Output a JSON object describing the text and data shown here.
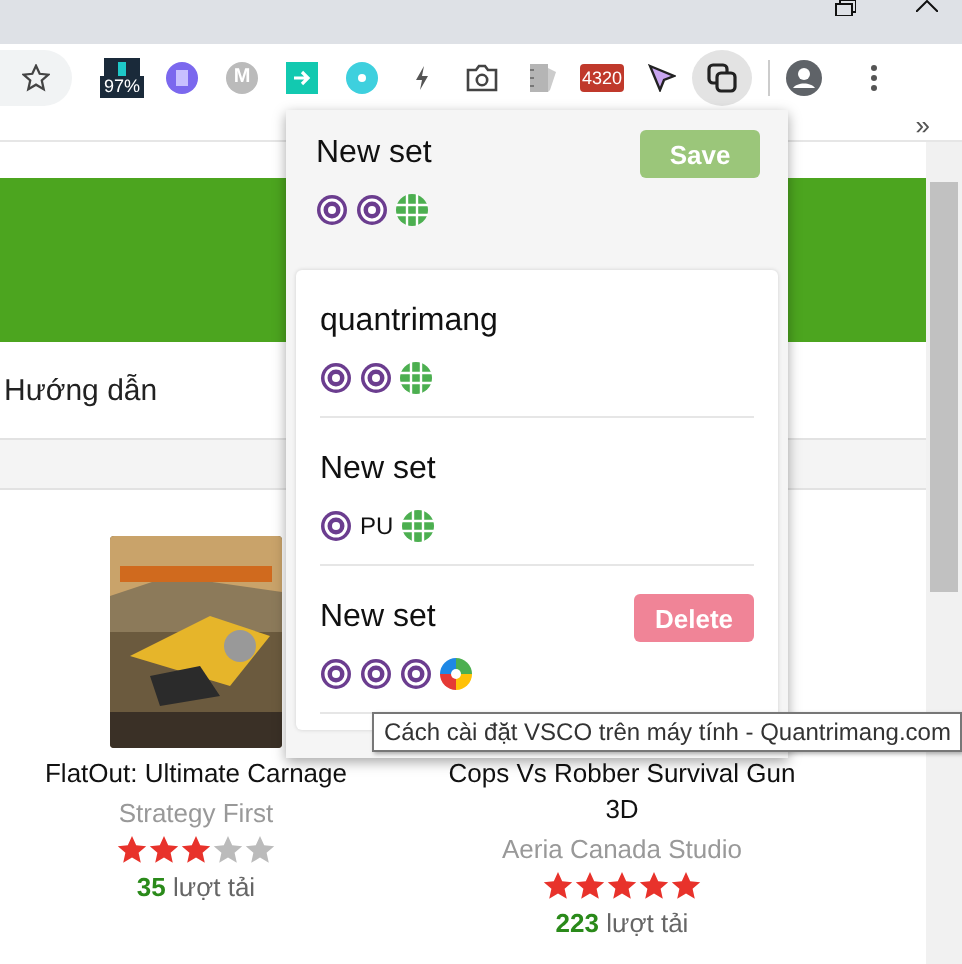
{
  "toolbar": {
    "extensions": [
      {
        "kind": "battery",
        "label": "97%"
      },
      {
        "kind": "purple-circle"
      },
      {
        "kind": "letter-circle",
        "label": "M"
      },
      {
        "kind": "arrow-square"
      },
      {
        "kind": "disc"
      },
      {
        "kind": "bolt"
      },
      {
        "kind": "camera"
      },
      {
        "kind": "notebook"
      },
      {
        "kind": "red-badge",
        "label": "4320"
      },
      {
        "kind": "cursor"
      },
      {
        "kind": "copy",
        "selected": true
      }
    ]
  },
  "bookmarks_bar": {
    "overflow": "»"
  },
  "page": {
    "nav_link": "Hướng dẫn",
    "games": [
      {
        "title": "FlatOut: Ultimate Carnage",
        "publisher": "Strategy First",
        "stars": 3,
        "downloads": "35",
        "downloads_label": "lượt tải"
      },
      {
        "title": "Cops Vs Robber Survival Gun 3D",
        "publisher": "Aeria Canada Studio",
        "stars": 5,
        "downloads": "223",
        "downloads_label": "lượt tải"
      }
    ]
  },
  "popup": {
    "new_set": {
      "name": "New set",
      "save_label": "Save",
      "icons": [
        {
          "kind": "at"
        },
        {
          "kind": "at"
        },
        {
          "kind": "globe"
        }
      ]
    },
    "sets": [
      {
        "name": "quantrimang",
        "icons": [
          {
            "kind": "at"
          },
          {
            "kind": "at"
          },
          {
            "kind": "globe"
          }
        ]
      },
      {
        "name": "New set",
        "icons": [
          {
            "kind": "at"
          },
          {
            "kind": "text",
            "label": "PU"
          },
          {
            "kind": "globe"
          }
        ]
      },
      {
        "name": "New set",
        "delete_label": "Delete",
        "icons": [
          {
            "kind": "at"
          },
          {
            "kind": "at"
          },
          {
            "kind": "at"
          },
          {
            "kind": "pinwheel"
          }
        ]
      }
    ]
  },
  "tooltip": "Cách cài đặt VSCO trên máy tính - Quantrimang.com"
}
